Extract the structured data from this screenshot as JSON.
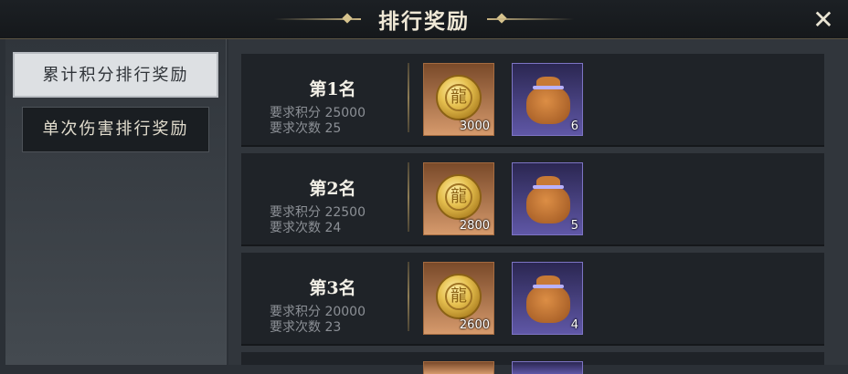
{
  "window": {
    "title": "排行奖励"
  },
  "colors": {
    "accent_gold": "#c8b482",
    "panel_bg": "#1f2328",
    "coin_frame": "#d69a6c",
    "bag_frame": "#5f57a6"
  },
  "sidebar": {
    "tabs": [
      {
        "label": "累计积分排行奖励",
        "active": true
      },
      {
        "label": "单次伤害排行奖励",
        "active": false
      }
    ]
  },
  "ranks": [
    {
      "title": "第1名",
      "score_req": "要求积分 25000",
      "count_req": "要求次数 25",
      "rewards": [
        {
          "icon": "gold-coin-icon",
          "qty": "3000"
        },
        {
          "icon": "treasure-bag-icon",
          "qty": "6"
        }
      ]
    },
    {
      "title": "第2名",
      "score_req": "要求积分 22500",
      "count_req": "要求次数 24",
      "rewards": [
        {
          "icon": "gold-coin-icon",
          "qty": "2800"
        },
        {
          "icon": "treasure-bag-icon",
          "qty": "5"
        }
      ]
    },
    {
      "title": "第3名",
      "score_req": "要求积分 20000",
      "count_req": "要求次数 23",
      "rewards": [
        {
          "icon": "gold-coin-icon",
          "qty": "2600"
        },
        {
          "icon": "treasure-bag-icon",
          "qty": "4"
        }
      ]
    }
  ]
}
